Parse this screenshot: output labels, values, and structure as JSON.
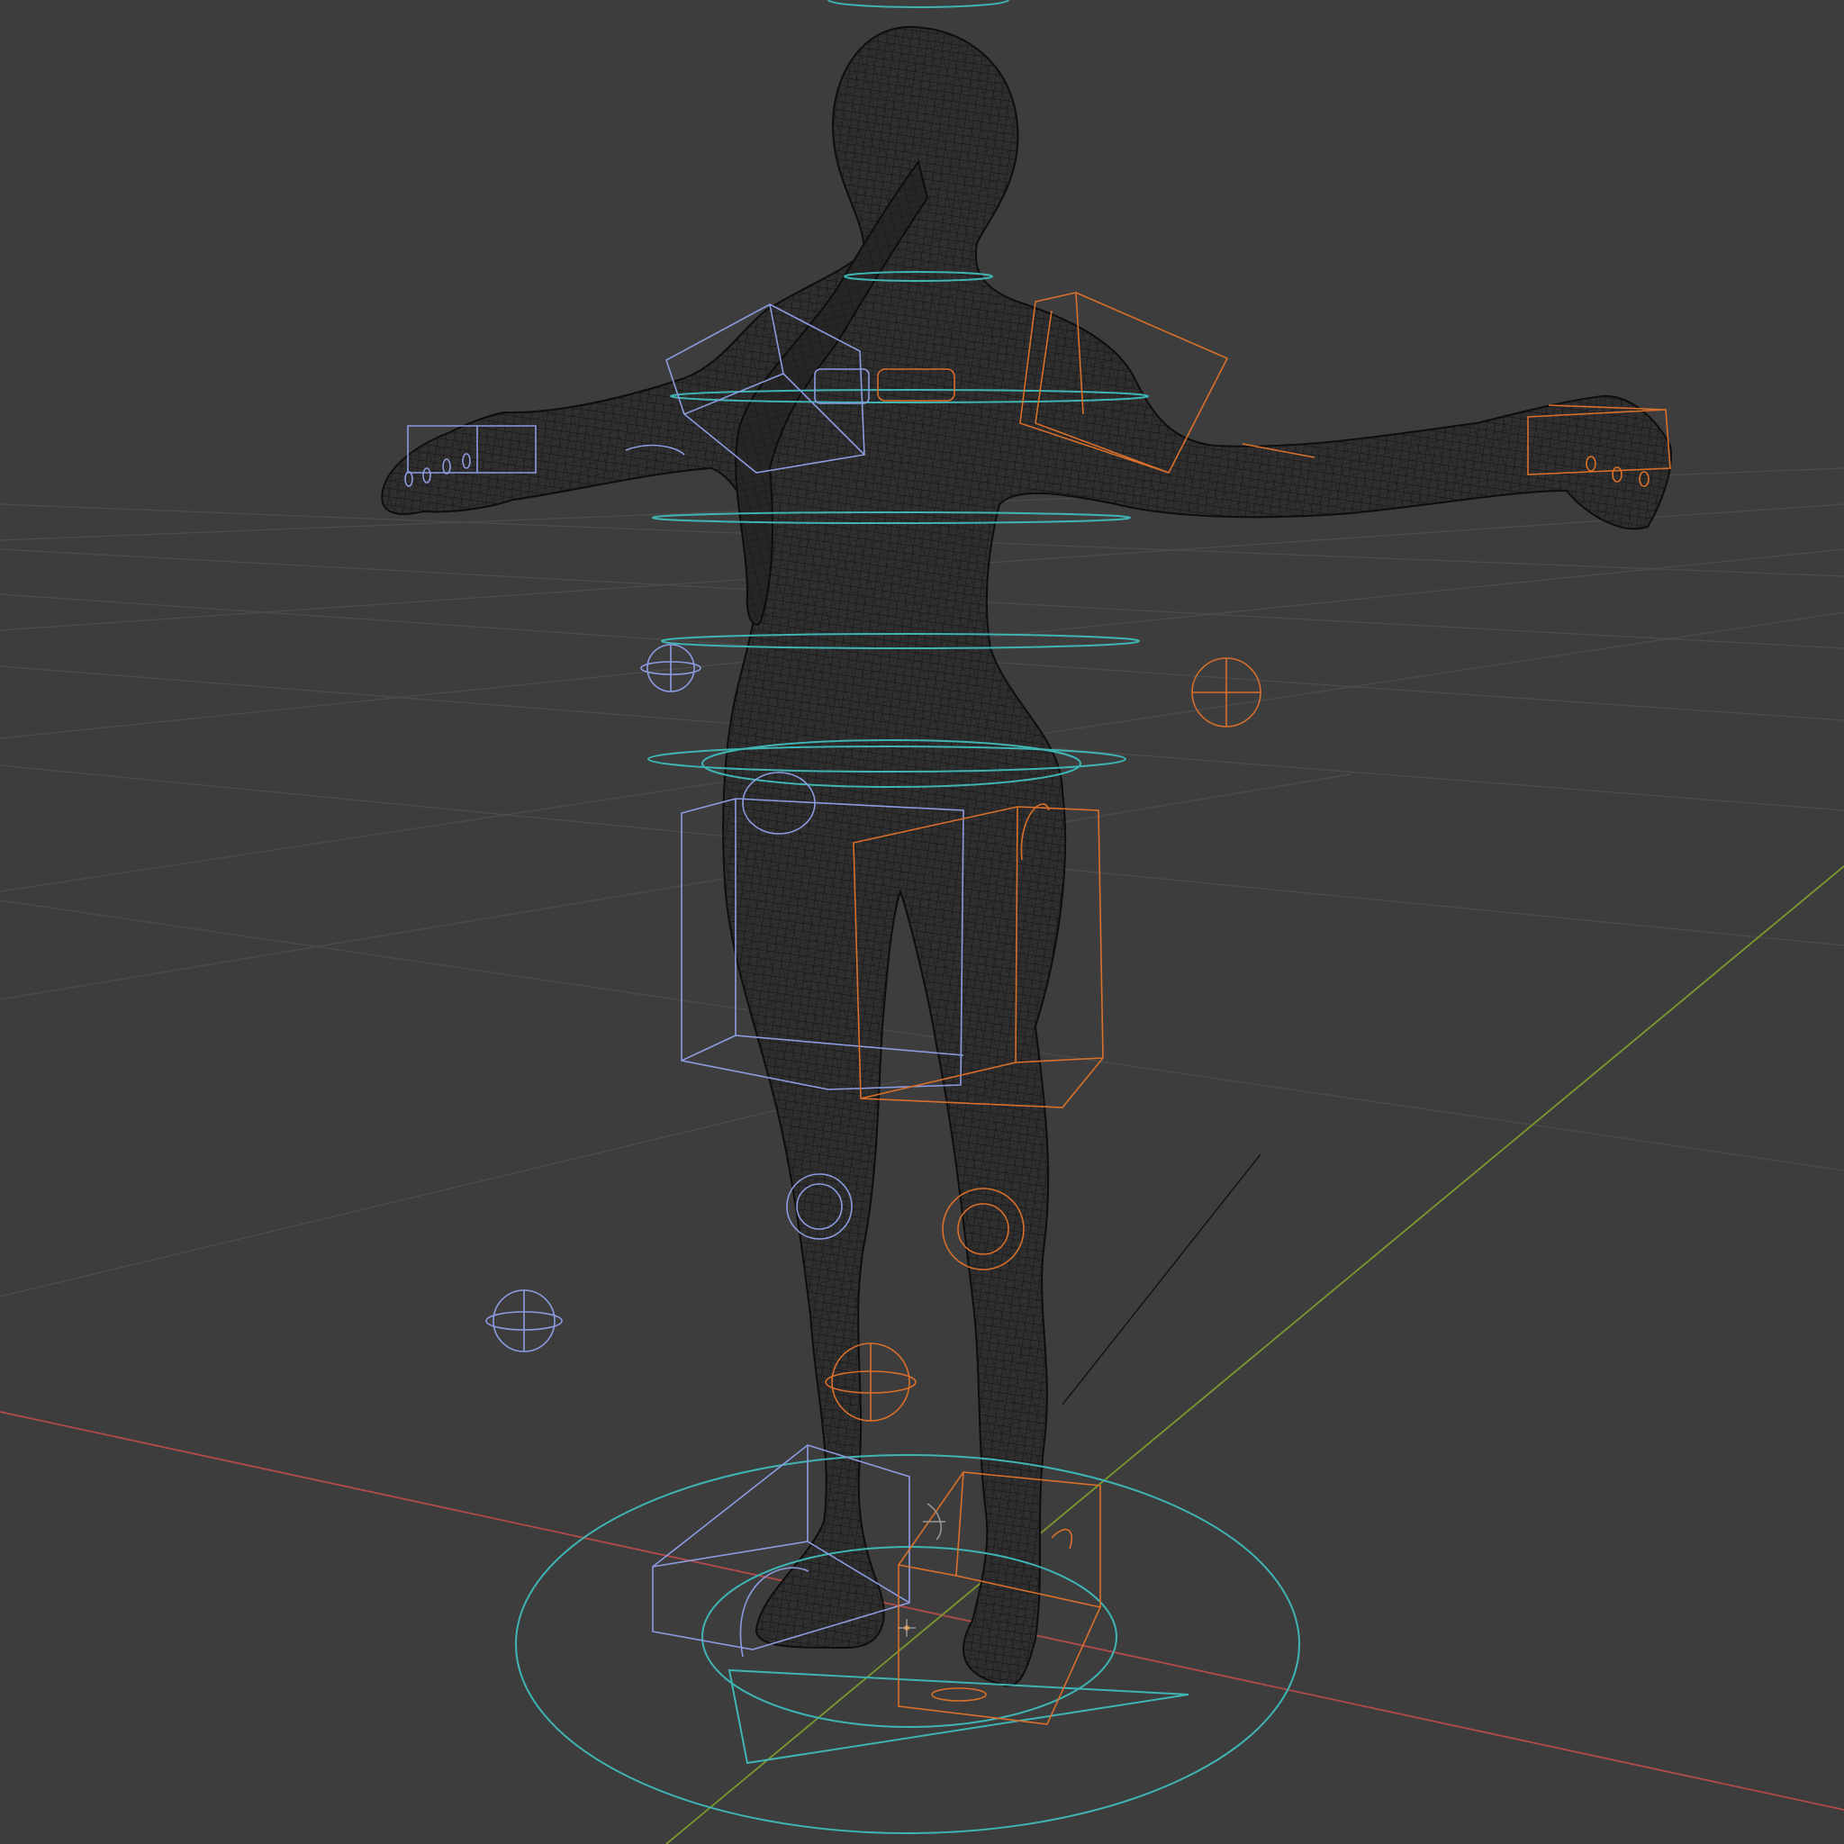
{
  "viewport": {
    "mode": "wireframe",
    "background": "#3d3d3d"
  },
  "colors": {
    "grid": "#4c4c4c",
    "x_axis": "#b34a4a",
    "y_axis": "#7a9a2e",
    "mesh": "#0f0f0f",
    "left_controls": "#8c9be0",
    "right_controls": "#d86f2a",
    "center_controls": "#3fb4b4",
    "origin": "#e07a1a"
  },
  "scene": {
    "object": "character-mesh",
    "armature": "rig-controls"
  }
}
